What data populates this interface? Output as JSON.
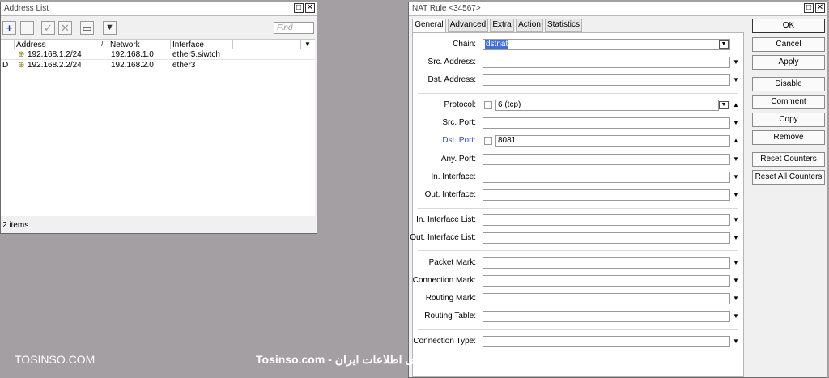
{
  "address_list": {
    "title": "Address List",
    "toolbar": {
      "add_icon": "plus-icon",
      "remove_icon": "minus-icon",
      "enable_icon": "check-icon",
      "disable_icon": "x-icon",
      "comment_icon": "note-icon",
      "filter_icon": "filter-icon"
    },
    "find_placeholder": "Find",
    "columns": [
      "Address",
      "Network",
      "Interface"
    ],
    "rows": [
      {
        "flag": "",
        "address": "192.168.1.2/24",
        "network": "192.168.1.0",
        "interface": "ether5.siwtch"
      },
      {
        "flag": "D",
        "address": "192.168.2.2/24",
        "network": "192.168.2.0",
        "interface": "ether3"
      }
    ],
    "status": "2 items"
  },
  "nat_rule": {
    "title": "NAT Rule <34567>",
    "tabs": [
      "General",
      "Advanced",
      "Extra",
      "Action",
      "Statistics"
    ],
    "active_tab": "General",
    "fields": {
      "chain": {
        "label": "Chain:",
        "value": "dstnat"
      },
      "src_address": {
        "label": "Src. Address:",
        "value": ""
      },
      "dst_address": {
        "label": "Dst. Address:",
        "value": ""
      },
      "protocol": {
        "label": "Protocol:",
        "value": "6 (tcp)"
      },
      "src_port": {
        "label": "Src. Port:",
        "value": ""
      },
      "dst_port": {
        "label": "Dst. Port:",
        "value": "8081"
      },
      "any_port": {
        "label": "Any. Port:",
        "value": ""
      },
      "in_interface": {
        "label": "In. Interface:",
        "value": ""
      },
      "out_interface": {
        "label": "Out. Interface:",
        "value": ""
      },
      "in_interface_list": {
        "label": "In. Interface List:",
        "value": ""
      },
      "out_interface_list": {
        "label": "Out. Interface List:",
        "value": ""
      },
      "packet_mark": {
        "label": "Packet Mark:",
        "value": ""
      },
      "connection_mark": {
        "label": "Connection Mark:",
        "value": ""
      },
      "routing_mark": {
        "label": "Routing Mark:",
        "value": ""
      },
      "routing_table": {
        "label": "Routing Table:",
        "value": ""
      },
      "connection_type": {
        "label": "Connection Type:",
        "value": ""
      }
    },
    "buttons": [
      "OK",
      "Cancel",
      "Apply",
      "Disable",
      "Comment",
      "Copy",
      "Remove",
      "Reset Counters",
      "Reset All Counters"
    ]
  },
  "watermark": {
    "left": "TOSINSO.COM",
    "center": "Tosinso.com - وب سایت تخصصی فناوری اطلاعات ایران"
  },
  "colors": {
    "desktop": "#a39fa3",
    "highlight": "#3f6fd8",
    "dst_port_label": "#2f4ad0"
  }
}
